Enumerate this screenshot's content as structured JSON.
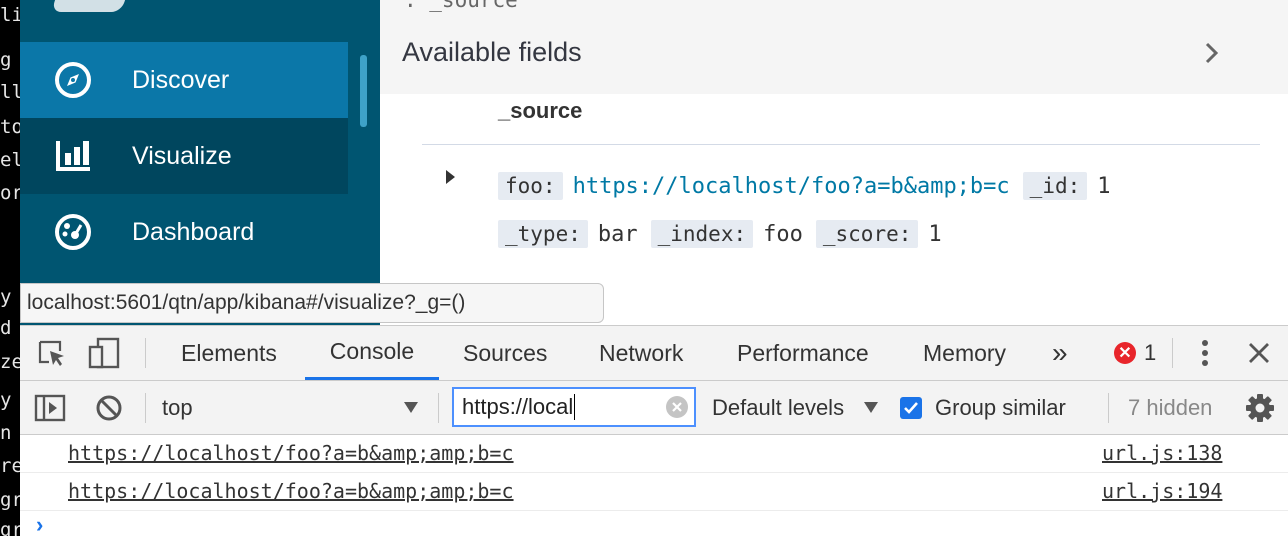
{
  "terminal": {
    "glyphs": [
      "li",
      "g",
      "lle",
      "",
      "to",
      "el",
      "or",
      "",
      "",
      "",
      "",
      "",
      "",
      "y",
      "d",
      "ze",
      "y",
      "n",
      "re",
      "gr",
      "gr"
    ]
  },
  "sidebar": {
    "items": [
      {
        "label": "Discover",
        "icon": "compass-icon"
      },
      {
        "label": "Visualize",
        "icon": "bar-chart-icon"
      },
      {
        "label": "Dashboard",
        "icon": "dashboard-gauge-icon"
      }
    ]
  },
  "main": {
    "prev_field": ": _source",
    "fields_title": "Available fields",
    "source_header": "_source",
    "doc": {
      "line1": [
        {
          "key": "foo:",
          "value": "https://localhost/foo?a=b&amp;b=c",
          "link": true
        },
        {
          "key": "_id:",
          "value": "1"
        }
      ],
      "line2": [
        {
          "key": "_type:",
          "value": "bar"
        },
        {
          "key": "_index:",
          "value": "foo"
        },
        {
          "key": "_score:",
          "value": "1"
        }
      ]
    }
  },
  "tooltip": {
    "url": "localhost:5601/qtn/app/kibana#/visualize?_g=()"
  },
  "devtools": {
    "tabs": [
      "Elements",
      "Console",
      "Sources",
      "Network",
      "Performance",
      "Memory"
    ],
    "active_tab": "Console",
    "more_tabs": "»",
    "error_count": "1",
    "context": "top",
    "filter": {
      "value": "https://local"
    },
    "levels": "Default levels",
    "group_similar": "Group similar",
    "hidden": "7 hidden",
    "messages": [
      {
        "text": "https://localhost/foo?a=b&amp;amp;b=c",
        "source": "url.js:138"
      },
      {
        "text": "https://localhost/foo?a=b&amp;amp;b=c",
        "source": "url.js:194"
      }
    ],
    "prompt": "›"
  },
  "colors": {
    "sidebar_bg": "#005571",
    "discover_active": "#0b77a8",
    "visualize_hover": "#00465e",
    "link": "#0079a5",
    "devtools_accent": "#1a73e8",
    "error_red": "#e8252b"
  }
}
